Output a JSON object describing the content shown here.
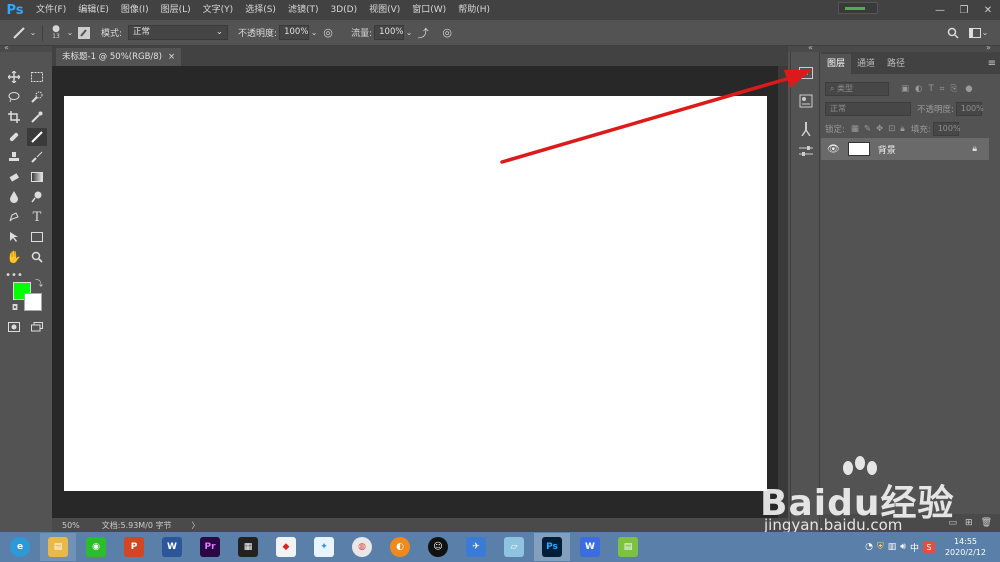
{
  "app": {
    "logo": "Ps",
    "menu": [
      "文件(F)",
      "编辑(E)",
      "图像(I)",
      "图层(L)",
      "文字(Y)",
      "选择(S)",
      "滤镜(T)",
      "3D(D)",
      "视图(V)",
      "窗口(W)",
      "帮助(H)"
    ],
    "window_controls": [
      "—",
      "❐",
      "✕"
    ]
  },
  "options": {
    "brush_size": "13",
    "mode_label": "模式:",
    "mode_value": "正常",
    "opacity_label": "不透明度:",
    "opacity_value": "100%",
    "flow_label": "流量:",
    "flow_value": "100%"
  },
  "document": {
    "tab_title": "未标题-1 @ 50%(RGB/8)",
    "tab_close": "×",
    "zoom": "50%",
    "doc_info": "文档:5.93M/0 字节",
    "status_arrow": "〉",
    "canvas_color": "#ffffff"
  },
  "colors": {
    "foreground": "#00ff00",
    "background": "#ffffff",
    "arrow": "#e02020"
  },
  "layers_panel": {
    "tabs": [
      "图层",
      "通道",
      "路径"
    ],
    "active_tab": "图层",
    "filter_label": "类型",
    "blend_mode": "正常",
    "opacity_label": "不透明度:",
    "opacity_value": "100%",
    "lock_label": "锁定:",
    "fill_label": "填充:",
    "fill_value": "100%",
    "layers": [
      {
        "name": "背景",
        "visible": true,
        "locked": true
      }
    ]
  },
  "watermark": {
    "brand": "Baidu经验",
    "url": "jingyan.baidu.com"
  },
  "taskbar": {
    "apps": [
      "browser",
      "file-explorer",
      "wechat",
      "powerpoint",
      "word",
      "premiere",
      "video-editor",
      "app-red",
      "app-bird",
      "chrome",
      "app-orange",
      "qq",
      "feishu",
      "app-notebook",
      "photoshop",
      "wps",
      "app-green"
    ],
    "time": "14:55",
    "date": "2020/2/12"
  }
}
